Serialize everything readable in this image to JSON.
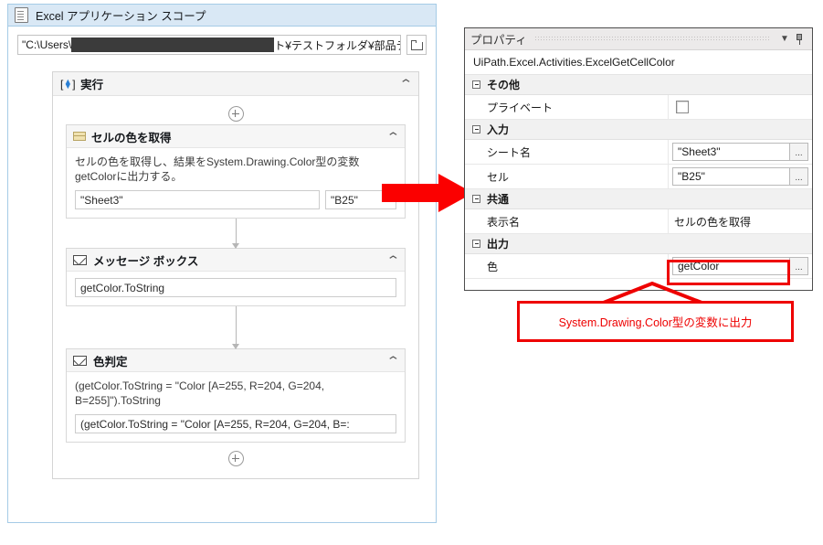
{
  "designer": {
    "title": "Excel アプリケーション スコープ",
    "title_icon": "excel-document-icon",
    "workbook_path_prefix": "\"C:\\Users\\",
    "workbook_path_suffix": "ト¥テストフォルダ¥部品テスト.xlsm\"",
    "browse_icon": "folder-icon",
    "sequence": {
      "label": "実行",
      "icon": "sequence-icon",
      "collapse_icon": "chevron-up-icon"
    },
    "activities": [
      {
        "label": "セルの色を取得",
        "icon": "cell-color-icon",
        "collapse_icon": "chevron-up-icon",
        "description": "セルの色を取得し、結果をSystem.Drawing.Color型の変数getColorに出力する。",
        "args": [
          {
            "name": "sheet-name",
            "value": "\"Sheet3\""
          },
          {
            "name": "cell",
            "value": "\"B25\""
          }
        ]
      },
      {
        "label": "メッセージ ボックス",
        "icon": "envelope-icon",
        "collapse_icon": "chevron-up-icon",
        "description": "",
        "args": [
          {
            "name": "message-text",
            "value": "getColor.ToString"
          }
        ]
      },
      {
        "label": "色判定",
        "icon": "envelope-icon",
        "collapse_icon": "chevron-up-icon",
        "description": "(getColor.ToString = \"Color [A=255, R=204, G=204, B=255]\").ToString",
        "args": [
          {
            "name": "message-text",
            "value": "(getColor.ToString = \"Color [A=255, R=204, G=204, B=:"
          }
        ]
      }
    ],
    "add_node_icon": "plus-circle-icon"
  },
  "properties": {
    "title": "プロパティ",
    "dropdown_icon": "chevron-down-icon",
    "pin_icon": "pin-icon",
    "type_name": "UiPath.Excel.Activities.ExcelGetCellColor",
    "groups": [
      {
        "label": "その他",
        "expander_icon": "minus-box-icon",
        "rows": [
          {
            "name": "プライベート",
            "control": "checkbox",
            "value": "",
            "checked": false
          }
        ]
      },
      {
        "label": "入力",
        "expander_icon": "minus-box-icon",
        "rows": [
          {
            "name": "シート名",
            "control": "input",
            "value": "\"Sheet3\"",
            "ellipsis": "..."
          },
          {
            "name": "セル",
            "control": "input",
            "value": "\"B25\"",
            "ellipsis": "..."
          }
        ]
      },
      {
        "label": "共通",
        "expander_icon": "minus-box-icon",
        "rows": [
          {
            "name": "表示名",
            "control": "plain",
            "value": "セルの色を取得"
          }
        ]
      },
      {
        "label": "出力",
        "expander_icon": "minus-box-icon",
        "rows": [
          {
            "name": "色",
            "control": "input",
            "value": "getColor",
            "ellipsis": "..."
          }
        ]
      }
    ]
  },
  "annotation": {
    "callout_text": "System.Drawing.Color型の変数に出力",
    "accent_color": "#ee0000",
    "arrow_name": "red-transition-arrow"
  }
}
